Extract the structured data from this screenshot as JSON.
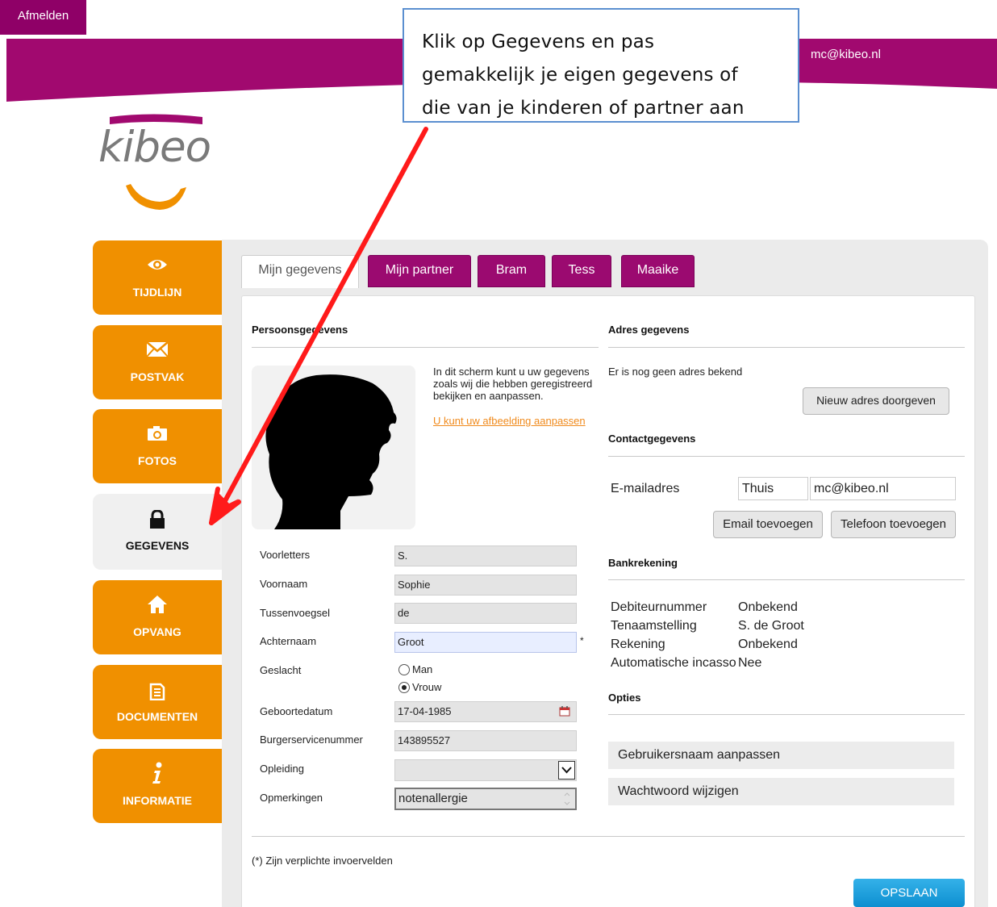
{
  "header": {
    "user_email": "mc@kibeo.nl",
    "logout_label": "Afmelden",
    "brand_color": "#a1096f"
  },
  "callout": {
    "lines": [
      "Klik op Gegevens en pas",
      "gemakkelijk je eigen gegevens of",
      "die van je kinderen of partner aan"
    ]
  },
  "logo": {
    "text": "kibeo"
  },
  "sidebar": {
    "items": [
      {
        "label": "TIJDLIJN",
        "icon": "eye-icon"
      },
      {
        "label": "POSTVAK",
        "icon": "envelope-icon"
      },
      {
        "label": "FOTOS",
        "icon": "camera-icon"
      },
      {
        "label": "GEGEVENS",
        "icon": "lock-icon",
        "active": true
      },
      {
        "label": "OPVANG",
        "icon": "home-icon"
      },
      {
        "label": "DOCUMENTEN",
        "icon": "document-icon"
      },
      {
        "label": "INFORMATIE",
        "icon": "info-icon"
      }
    ]
  },
  "tabs": [
    {
      "label": "Mijn gegevens",
      "active": true
    },
    {
      "label": "Mijn partner"
    },
    {
      "label": "Bram"
    },
    {
      "label": "Tess"
    },
    {
      "label": "Maaike"
    }
  ],
  "personal": {
    "heading": "Persoonsgegevens",
    "intro": "In dit scherm kunt u uw gegevens zoals wij die hebben geregistreerd bekijken en aanpassen.",
    "edit_photo_link": "U kunt uw afbeelding aanpassen",
    "fields": {
      "initials": {
        "label": "Voorletters",
        "value": "S."
      },
      "first_name": {
        "label": "Voornaam",
        "value": "Sophie"
      },
      "prefix": {
        "label": "Tussenvoegsel",
        "value": "de"
      },
      "last_name": {
        "label": "Achternaam",
        "value": "Groot",
        "required_mark": "*"
      },
      "gender": {
        "label": "Geslacht",
        "options": [
          "Man",
          "Vrouw"
        ],
        "selected": "Vrouw"
      },
      "birthdate": {
        "label": "Geboortedatum",
        "value": "17-04-1985"
      },
      "bsn": {
        "label": "Burgerservicenummer",
        "value": "143895527"
      },
      "education": {
        "label": "Opleiding",
        "value": ""
      },
      "remarks": {
        "label": "Opmerkingen",
        "value": "notenallergie"
      }
    }
  },
  "address": {
    "heading": "Adres gegevens",
    "empty_text": "Er is nog geen adres bekend",
    "new_address_button": "Nieuw adres doorgeven"
  },
  "contact": {
    "heading": "Contactgegevens",
    "email_label": "E-mailadres",
    "email_type": "Thuis",
    "email_value": "mc@kibeo.nl",
    "add_email_button": "Email toevoegen",
    "add_phone_button": "Telefoon toevoegen"
  },
  "bank": {
    "heading": "Bankrekening",
    "rows": [
      {
        "label": "Debiteurnummer",
        "value": "Onbekend"
      },
      {
        "label": "Tenaamstelling",
        "value": "S. de Groot"
      },
      {
        "label": "Rekening",
        "value": "Onbekend"
      },
      {
        "label": "Automatische incasso",
        "value": "Nee"
      }
    ]
  },
  "options": {
    "heading": "Opties",
    "items": [
      "Gebruikersnaam aanpassen",
      "Wachtwoord wijzigen"
    ]
  },
  "footer": {
    "required_note": "(*) Zijn verplichte invoervelden",
    "save_label": "OPSLAAN"
  },
  "colors": {
    "accent_orange": "#f09000",
    "tab_purple": "#9b0a70",
    "save_blue": "#1a9ddc",
    "arrow_red": "#ff1a1a"
  }
}
